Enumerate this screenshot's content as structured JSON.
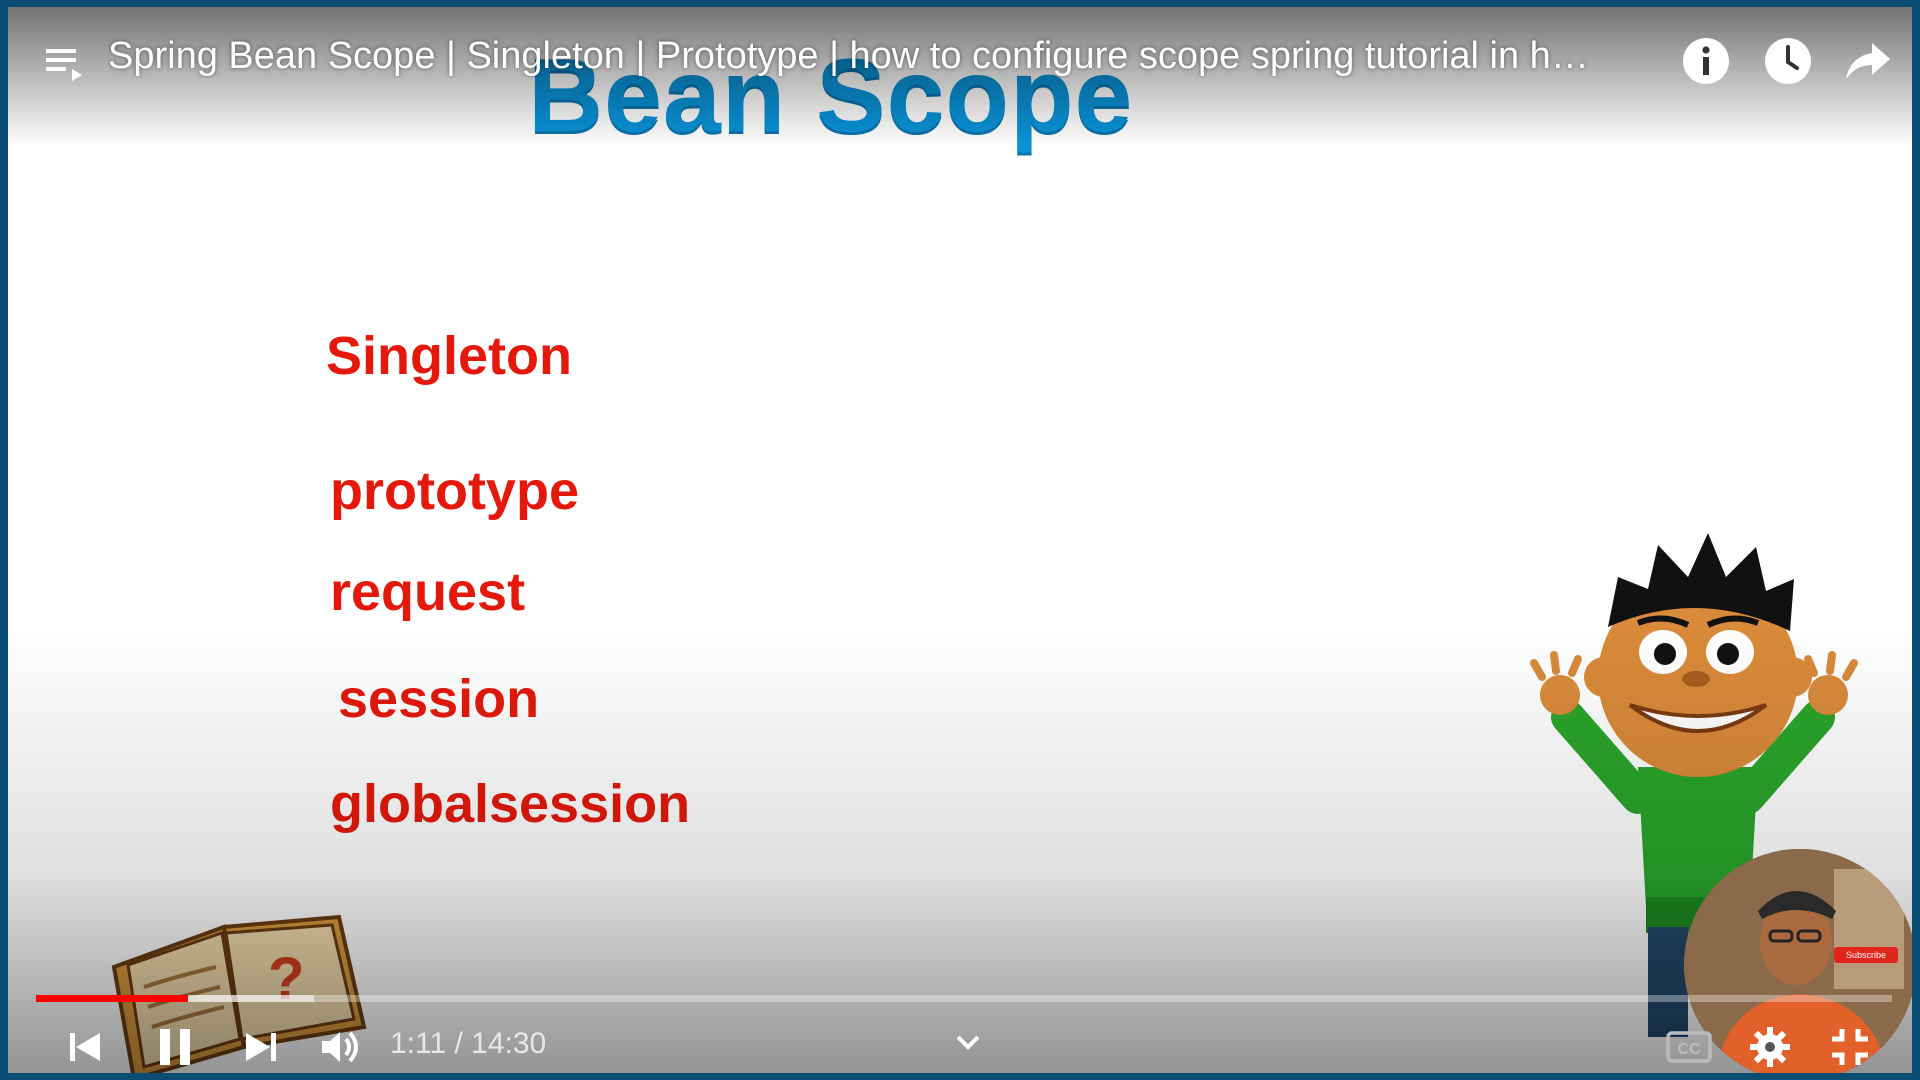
{
  "video": {
    "title": "Spring Bean Scope | Singleton | Prototype | how to configure scope spring tutorial in h…"
  },
  "slide": {
    "heading": "Bean Scope",
    "items": [
      "Singleton",
      "prototype",
      "request",
      "session",
      "globalsession"
    ]
  },
  "player": {
    "time": "1:11 / 14:30",
    "progress_played": 0.082,
    "progress_buffered": 0.15,
    "cc_label": "CC",
    "subscribe_label": "Subscribe"
  },
  "icons": {
    "playlist": "playlist-icon",
    "info": "info-icon",
    "watch_later": "clock-icon",
    "share": "share-icon",
    "prev": "previous-icon",
    "pause": "pause-icon",
    "next": "next-icon",
    "volume": "volume-icon",
    "chevron": "chevron-down-icon",
    "cc": "captions-icon",
    "settings": "gear-icon",
    "fullscreen": "exit-fullscreen-icon"
  },
  "colors": {
    "heading": "#0a93d8",
    "item": "#e4190b",
    "progress_played": "#ff0000",
    "frame_border": "#0a4d73"
  }
}
